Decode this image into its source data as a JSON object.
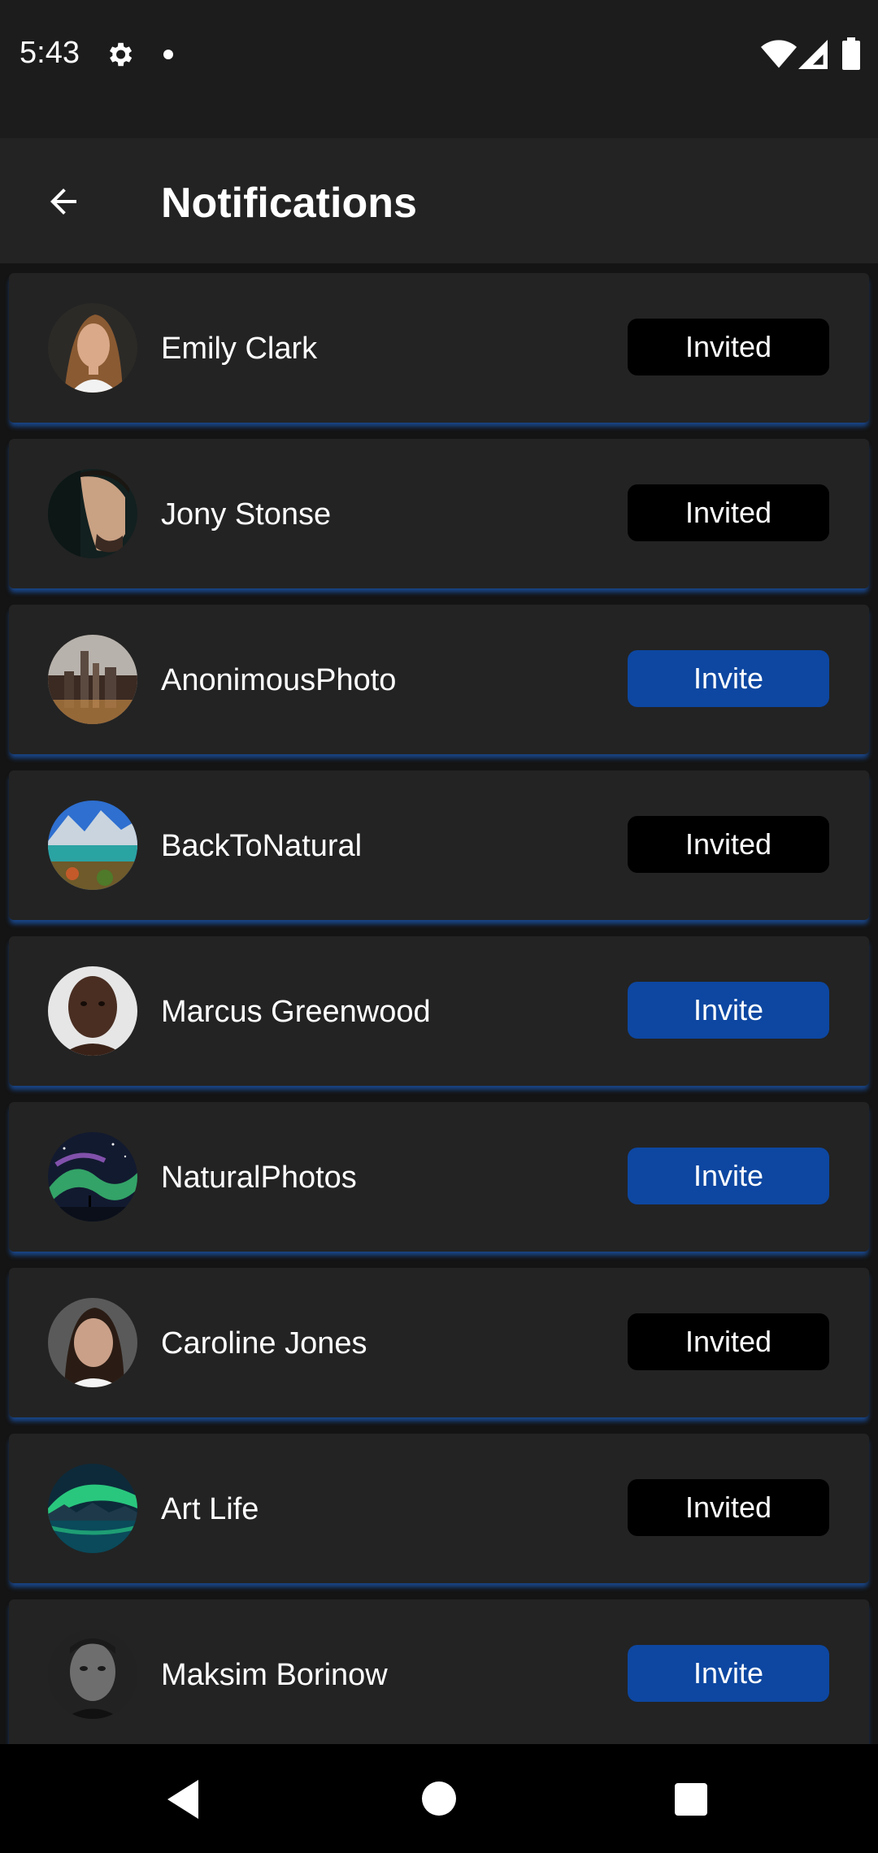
{
  "status_bar": {
    "time": "5:43",
    "icons": [
      "gear-icon",
      "notification-dot-icon",
      "wifi-icon",
      "signal-icon",
      "battery-icon"
    ]
  },
  "app_bar": {
    "title": "Notifications",
    "back_icon": "arrow-left-icon"
  },
  "colors": {
    "background": "#141414",
    "card": "#232323",
    "invite_button": "#0d47a1",
    "invited_button": "#000000",
    "card_glow": "#1e6ee6"
  },
  "users": [
    {
      "name": "Emily Clark",
      "button": "Invited",
      "avatar": "portrait-woman-avatar"
    },
    {
      "name": "Jony Stonse",
      "button": "Invited",
      "avatar": "portrait-man-avatar"
    },
    {
      "name": "AnonimousPhoto",
      "button": "Invite",
      "avatar": "city-night-avatar"
    },
    {
      "name": "BackToNatural",
      "button": "Invited",
      "avatar": "mountain-lake-avatar"
    },
    {
      "name": "Marcus Greenwood",
      "button": "Invite",
      "avatar": "portrait-man-avatar"
    },
    {
      "name": "NaturalPhotos",
      "button": "Invite",
      "avatar": "aurora-sky-avatar"
    },
    {
      "name": "Caroline Jones",
      "button": "Invited",
      "avatar": "portrait-woman-avatar"
    },
    {
      "name": "Art Life",
      "button": "Invited",
      "avatar": "aurora-landscape-avatar"
    },
    {
      "name": "Maksim Borinow",
      "button": "Invite",
      "avatar": "portrait-man-bw-avatar"
    }
  ],
  "nav_bar": {
    "buttons": [
      "nav-back-icon",
      "nav-home-icon",
      "nav-recents-icon"
    ]
  }
}
